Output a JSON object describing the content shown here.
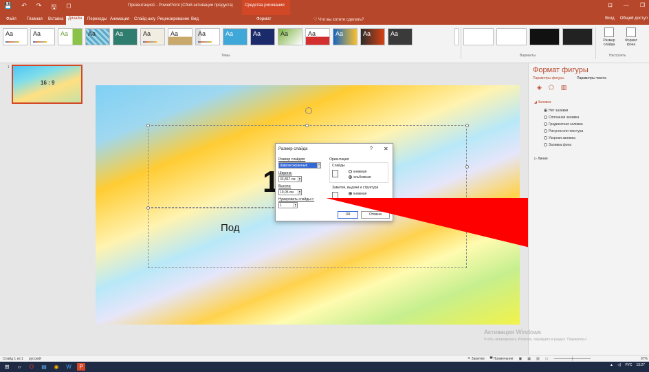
{
  "titlebar": {
    "title": "Презентация1 - PowerPoint (Сбой активации продукта)",
    "context_tab": "Средства рисования",
    "qat": [
      "💾",
      "↶",
      "↷",
      "🖫",
      "◻"
    ],
    "win": [
      "⊡",
      "—",
      "❐"
    ]
  },
  "tabs": {
    "items": [
      "Файл",
      "Главная",
      "Вставка",
      "Дизайн",
      "Переходы",
      "Анимация",
      "Слайд-шоу",
      "Рецензирование",
      "Вид",
      "Формат"
    ],
    "active": "Дизайн",
    "tell_me": "♡ Что вы хотите сделать?",
    "signin": "Вход",
    "share": "Общий доступ"
  },
  "ribbon": {
    "themes_label": "Темы",
    "variants_label": "Варианты",
    "customize_label": "Настроить",
    "theme_sample": "Aa",
    "slide_size_label": "Размер слайда",
    "format_bg_label": "Формат фона"
  },
  "thumbs": {
    "number": "1",
    "label": "16 : 9"
  },
  "slide": {
    "title_fragment": "1",
    "subtitle_fragment": "Под"
  },
  "dialog": {
    "title": "Размер слайда",
    "help": "?",
    "close": "✕",
    "size_label": "Размер слайдов:",
    "size_value": "Широкоэкранный",
    "width_label": "Ширина:",
    "width_value": "33,867 см",
    "height_label": "Высота:",
    "height_value": "19,05 см",
    "number_label": "Нумеровать слайды с:",
    "number_value": "1",
    "orientation_label": "Ориентация",
    "slides_label": "Слайды",
    "portrait": "книжная",
    "landscape": "альбомная",
    "notes_label": "Заметки, выдачи и структура",
    "notes_portrait": "книжная",
    "ok": "ОК",
    "cancel": "Отмена"
  },
  "format_pane": {
    "title": "Формат фигуры",
    "tab_shape": "Параметры фигуры",
    "tab_text": "Параметры текста",
    "fill_section": "◢ Заливка",
    "fill_options": [
      "Нет заливки",
      "Сплошная заливка",
      "Градиентная заливка",
      "Рисунок или текстура",
      "Узорная заливка",
      "Заливка фона"
    ],
    "selected_index": 0,
    "line_section": "▷ Линия",
    "icons": [
      "◈",
      "⬠",
      "▥"
    ]
  },
  "watermark": {
    "line1": "Активация Windows",
    "line2": "Чтобы активировать Windows, перейдите в раздел \"Параметры\"."
  },
  "statusbar": {
    "slide_info": "Слайд 1 из 1",
    "lang": "русский",
    "notes": "≙ Заметки",
    "comments": "▀ Примечания",
    "zoom": "97%"
  },
  "taskbar": {
    "tray_lang": "РУС",
    "time": "13:27"
  },
  "colors": {
    "accent": "#b7472a",
    "arrow": "#ff0000"
  }
}
